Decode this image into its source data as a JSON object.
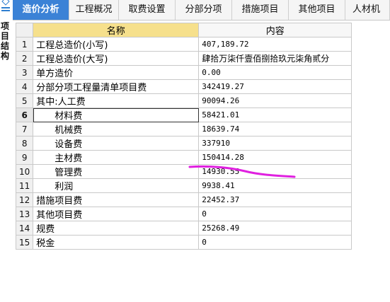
{
  "left_panel": {
    "label": "项目结构"
  },
  "tabs": [
    {
      "label": "造价分析",
      "active": true
    },
    {
      "label": "工程概况",
      "active": false
    },
    {
      "label": "取费设置",
      "active": false
    },
    {
      "label": "分部分项",
      "active": false
    },
    {
      "label": "措施项目",
      "active": false
    },
    {
      "label": "其他项目",
      "active": false
    },
    {
      "label": "人材机",
      "active": false
    }
  ],
  "table": {
    "headers": {
      "number": "",
      "name": "名称",
      "content": "内容"
    },
    "rows": [
      {
        "num": "1",
        "name": "工程总造价(小写)",
        "value": "407,189.72",
        "indent": false
      },
      {
        "num": "2",
        "name": "工程总造价(大写)",
        "value": "肆拾万柒仟壹佰捌拾玖元柒角贰分",
        "indent": false
      },
      {
        "num": "3",
        "name": "单方造价",
        "value": "0.00",
        "indent": false
      },
      {
        "num": "4",
        "name": "分部分项工程量清单项目费",
        "value": "342419.27",
        "indent": false
      },
      {
        "num": "5",
        "name": "其中:人工费",
        "value": "90094.26",
        "indent": false
      },
      {
        "num": "6",
        "name": "材料费",
        "value": "58421.01",
        "indent": true,
        "selected": true
      },
      {
        "num": "7",
        "name": "机械费",
        "value": "18639.74",
        "indent": true
      },
      {
        "num": "8",
        "name": "设备费",
        "value": "337910",
        "indent": true
      },
      {
        "num": "9",
        "name": "主材费",
        "value": "150414.28",
        "indent": true
      },
      {
        "num": "10",
        "name": "管理费",
        "value": "14930.55",
        "indent": true
      },
      {
        "num": "11",
        "name": "利润",
        "value": "9938.41",
        "indent": true
      },
      {
        "num": "12",
        "name": "措施项目费",
        "value": "22452.37",
        "indent": false
      },
      {
        "num": "13",
        "name": "其他项目费",
        "value": "0",
        "indent": false
      },
      {
        "num": "14",
        "name": "规费",
        "value": "25268.49",
        "indent": false
      },
      {
        "num": "15",
        "name": "税金",
        "value": "0",
        "indent": false
      }
    ]
  },
  "colors": {
    "tab_active": "#3b82d6",
    "header_name_bg": "#f6e08c",
    "annotation_stroke": "#e020e0"
  }
}
